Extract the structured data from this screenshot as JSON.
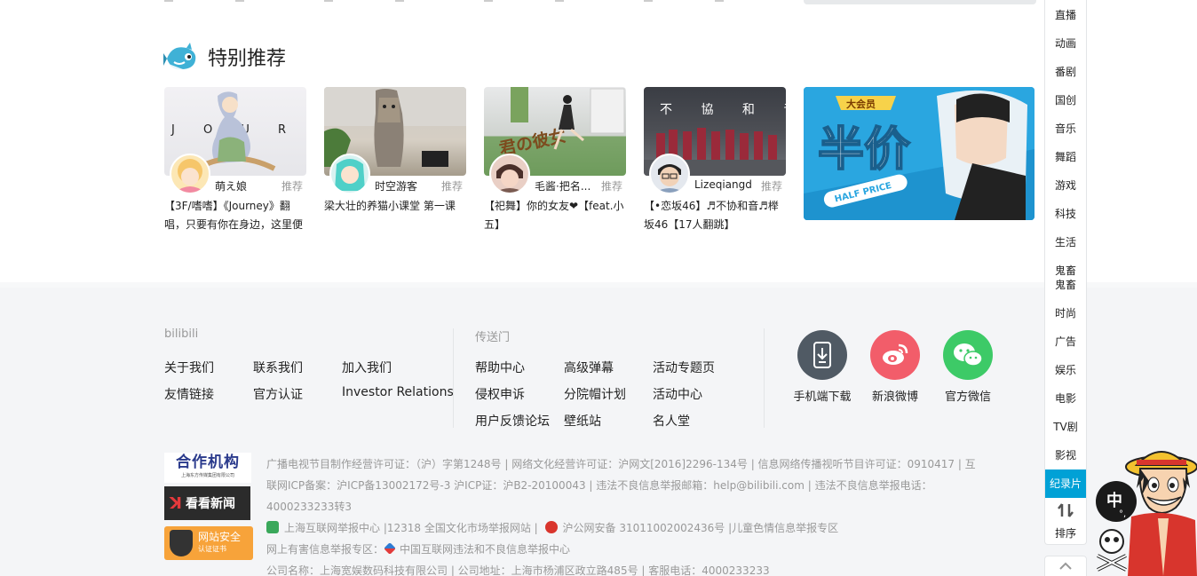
{
  "section": {
    "title": "特别推荐"
  },
  "cards": [
    {
      "user": "萌え娘",
      "tag": "推荐",
      "title": "【3F/嗜嗜】《Journey》翻唱，只要有你在身边，这里便"
    },
    {
      "user": "时空游客",
      "tag": "推荐",
      "title": "梁大壮的养猫小课堂 第一课"
    },
    {
      "user": "毛酱·把名...",
      "tag": "推荐",
      "title": "【祀舞】你的女友❤【feat.小五】"
    },
    {
      "user": "Lizeqiangd",
      "tag": "推荐",
      "title": "【•恋坂46】♬不协和音♬榉坂46【17人翻跳】"
    }
  ],
  "card_thumbs": {
    "thumb1_text": "J O U R N E Y",
    "thumb3_text": "君の彼女",
    "thumb4_text": "不 協 和 音"
  },
  "banner": {
    "badge": "大会员",
    "main": "半价",
    "sub": "HALF PRICE"
  },
  "footer": {
    "col1": {
      "title": "bilibili",
      "links": [
        "关于我们",
        "联系我们",
        "加入我们",
        "友情链接",
        "官方认证",
        "Investor Relations"
      ]
    },
    "col2": {
      "title": "传送门",
      "links": [
        "帮助中心",
        "高级弹幕",
        "活动专题页",
        "侵权申诉",
        "分院帽计划",
        "活动中心",
        "用户反馈论坛",
        "壁纸站",
        "名人堂"
      ]
    },
    "apps": [
      {
        "label": "手机端下载",
        "color": "#505a64",
        "icon": "phone-download-icon"
      },
      {
        "label": "新浪微博",
        "color": "#f25d6a",
        "icon": "weibo-icon"
      },
      {
        "label": "官方微信",
        "color": "#3dca67",
        "icon": "wechat-icon"
      }
    ],
    "logos": {
      "hz_title": "合作机构",
      "hz_sub": "上海东方传媒集团有限公司",
      "kk": "看看新闻",
      "aq_title": "网站安全",
      "aq_sub": "认证证书"
    },
    "legal": {
      "line1": "广播电视节目制作经营许可证：（沪）字第1248号 | 网络文化经营许可证：沪网文[2016]2296-134号 | 信息网络传播视听节目许可证：0910417 | 互联网ICP备案：沪ICP备13002172号-3 沪ICP证：沪B2-20100043 | 违法不良信息举报邮箱：help@bilibili.com | 违法不良信息举报电话：4000233233转3",
      "line2": "上海互联网举报中心 |12318 全国文化市场举报网站 |",
      "line2b": "沪公网安备 31011002002436号 |儿童色情信息举报专区",
      "line3a": "网上有害信息举报专区：",
      "line3b": "中国互联网违法和不良信息举报中心",
      "line4": "公司名称：上海宽娱数码科技有限公司 | 公司地址：上海市杨浦区政立路485号 | 客服电话：4000233233"
    }
  },
  "rnav": {
    "items": [
      "直播",
      "动画",
      "番剧",
      "国创",
      "音乐",
      "舞蹈",
      "游戏",
      "科技",
      "生活",
      "鬼畜",
      "时尚",
      "广告",
      "娱乐",
      "电影",
      "TV剧",
      "影视",
      "纪录片"
    ],
    "guichu_line2": "鬼畜",
    "sort_label": "排序",
    "active": "纪录片"
  },
  "colors": {
    "accent": "#00a1d6",
    "footer_bg": "#f4f5f7"
  }
}
